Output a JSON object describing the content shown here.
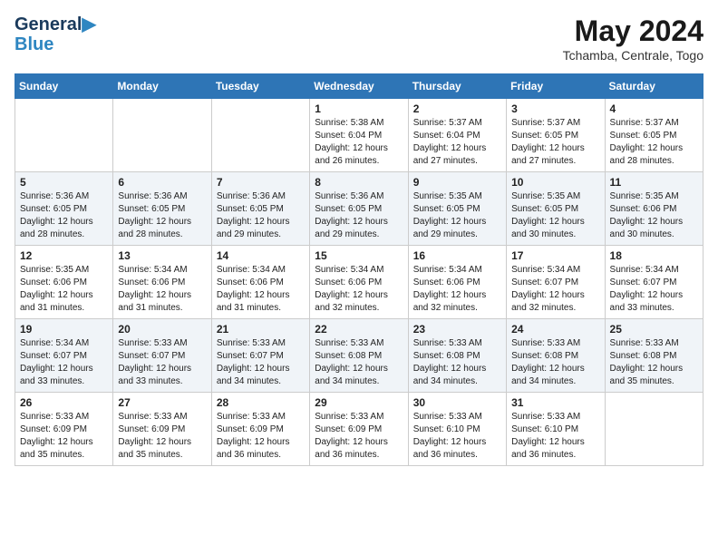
{
  "header": {
    "logo_line1": "General",
    "logo_line2": "Blue",
    "month_year": "May 2024",
    "location": "Tchamba, Centrale, Togo"
  },
  "days_of_week": [
    "Sunday",
    "Monday",
    "Tuesday",
    "Wednesday",
    "Thursday",
    "Friday",
    "Saturday"
  ],
  "weeks": [
    [
      {
        "day": "",
        "content": ""
      },
      {
        "day": "",
        "content": ""
      },
      {
        "day": "",
        "content": ""
      },
      {
        "day": "1",
        "content": "Sunrise: 5:38 AM\nSunset: 6:04 PM\nDaylight: 12 hours\nand 26 minutes."
      },
      {
        "day": "2",
        "content": "Sunrise: 5:37 AM\nSunset: 6:04 PM\nDaylight: 12 hours\nand 27 minutes."
      },
      {
        "day": "3",
        "content": "Sunrise: 5:37 AM\nSunset: 6:05 PM\nDaylight: 12 hours\nand 27 minutes."
      },
      {
        "day": "4",
        "content": "Sunrise: 5:37 AM\nSunset: 6:05 PM\nDaylight: 12 hours\nand 28 minutes."
      }
    ],
    [
      {
        "day": "5",
        "content": "Sunrise: 5:36 AM\nSunset: 6:05 PM\nDaylight: 12 hours\nand 28 minutes."
      },
      {
        "day": "6",
        "content": "Sunrise: 5:36 AM\nSunset: 6:05 PM\nDaylight: 12 hours\nand 28 minutes."
      },
      {
        "day": "7",
        "content": "Sunrise: 5:36 AM\nSunset: 6:05 PM\nDaylight: 12 hours\nand 29 minutes."
      },
      {
        "day": "8",
        "content": "Sunrise: 5:36 AM\nSunset: 6:05 PM\nDaylight: 12 hours\nand 29 minutes."
      },
      {
        "day": "9",
        "content": "Sunrise: 5:35 AM\nSunset: 6:05 PM\nDaylight: 12 hours\nand 29 minutes."
      },
      {
        "day": "10",
        "content": "Sunrise: 5:35 AM\nSunset: 6:05 PM\nDaylight: 12 hours\nand 30 minutes."
      },
      {
        "day": "11",
        "content": "Sunrise: 5:35 AM\nSunset: 6:06 PM\nDaylight: 12 hours\nand 30 minutes."
      }
    ],
    [
      {
        "day": "12",
        "content": "Sunrise: 5:35 AM\nSunset: 6:06 PM\nDaylight: 12 hours\nand 31 minutes."
      },
      {
        "day": "13",
        "content": "Sunrise: 5:34 AM\nSunset: 6:06 PM\nDaylight: 12 hours\nand 31 minutes."
      },
      {
        "day": "14",
        "content": "Sunrise: 5:34 AM\nSunset: 6:06 PM\nDaylight: 12 hours\nand 31 minutes."
      },
      {
        "day": "15",
        "content": "Sunrise: 5:34 AM\nSunset: 6:06 PM\nDaylight: 12 hours\nand 32 minutes."
      },
      {
        "day": "16",
        "content": "Sunrise: 5:34 AM\nSunset: 6:06 PM\nDaylight: 12 hours\nand 32 minutes."
      },
      {
        "day": "17",
        "content": "Sunrise: 5:34 AM\nSunset: 6:07 PM\nDaylight: 12 hours\nand 32 minutes."
      },
      {
        "day": "18",
        "content": "Sunrise: 5:34 AM\nSunset: 6:07 PM\nDaylight: 12 hours\nand 33 minutes."
      }
    ],
    [
      {
        "day": "19",
        "content": "Sunrise: 5:34 AM\nSunset: 6:07 PM\nDaylight: 12 hours\nand 33 minutes."
      },
      {
        "day": "20",
        "content": "Sunrise: 5:33 AM\nSunset: 6:07 PM\nDaylight: 12 hours\nand 33 minutes."
      },
      {
        "day": "21",
        "content": "Sunrise: 5:33 AM\nSunset: 6:07 PM\nDaylight: 12 hours\nand 34 minutes."
      },
      {
        "day": "22",
        "content": "Sunrise: 5:33 AM\nSunset: 6:08 PM\nDaylight: 12 hours\nand 34 minutes."
      },
      {
        "day": "23",
        "content": "Sunrise: 5:33 AM\nSunset: 6:08 PM\nDaylight: 12 hours\nand 34 minutes."
      },
      {
        "day": "24",
        "content": "Sunrise: 5:33 AM\nSunset: 6:08 PM\nDaylight: 12 hours\nand 34 minutes."
      },
      {
        "day": "25",
        "content": "Sunrise: 5:33 AM\nSunset: 6:08 PM\nDaylight: 12 hours\nand 35 minutes."
      }
    ],
    [
      {
        "day": "26",
        "content": "Sunrise: 5:33 AM\nSunset: 6:09 PM\nDaylight: 12 hours\nand 35 minutes."
      },
      {
        "day": "27",
        "content": "Sunrise: 5:33 AM\nSunset: 6:09 PM\nDaylight: 12 hours\nand 35 minutes."
      },
      {
        "day": "28",
        "content": "Sunrise: 5:33 AM\nSunset: 6:09 PM\nDaylight: 12 hours\nand 36 minutes."
      },
      {
        "day": "29",
        "content": "Sunrise: 5:33 AM\nSunset: 6:09 PM\nDaylight: 12 hours\nand 36 minutes."
      },
      {
        "day": "30",
        "content": "Sunrise: 5:33 AM\nSunset: 6:10 PM\nDaylight: 12 hours\nand 36 minutes."
      },
      {
        "day": "31",
        "content": "Sunrise: 5:33 AM\nSunset: 6:10 PM\nDaylight: 12 hours\nand 36 minutes."
      },
      {
        "day": "",
        "content": ""
      }
    ]
  ]
}
